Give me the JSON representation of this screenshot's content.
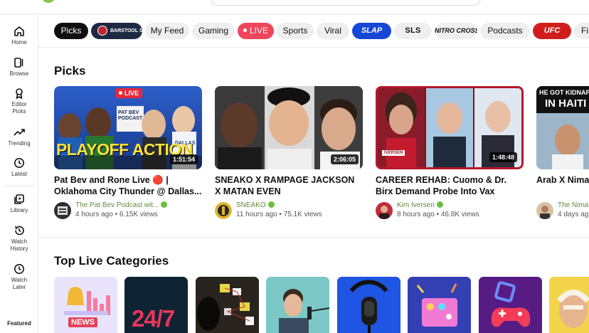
{
  "sidebar": {
    "items": [
      {
        "label": "Home",
        "icon": "home-icon"
      },
      {
        "label": "Browse",
        "icon": "browse-icon"
      },
      {
        "label": "Editor\nPicks",
        "icon": "award-icon"
      },
      {
        "label": "Trending",
        "icon": "trending-icon"
      },
      {
        "label": "Latest",
        "icon": "clock-icon"
      },
      {
        "label": "Library",
        "icon": "library-icon"
      },
      {
        "label": "Watch\nHistory",
        "icon": "history-icon"
      },
      {
        "label": "Watch\nLater",
        "icon": "clock-icon"
      }
    ],
    "featured_label": "Featured"
  },
  "chips": [
    {
      "label": "Picks",
      "style": "selected"
    },
    {
      "label": "BARSTOOL SPORTS",
      "style": "barstool"
    },
    {
      "label": "My Feed",
      "style": "default"
    },
    {
      "label": "Gaming",
      "style": "default"
    },
    {
      "label": "LIVE",
      "style": "live"
    },
    {
      "label": "Sports",
      "style": "default"
    },
    {
      "label": "Viral",
      "style": "default"
    },
    {
      "label": "SLAP",
      "style": "slap"
    },
    {
      "label": "SLS",
      "style": "logo"
    },
    {
      "label": "NITRO CROSS",
      "style": "logo"
    },
    {
      "label": "Podcasts",
      "style": "default"
    },
    {
      "label": "UFC",
      "style": "ufc"
    },
    {
      "label": "Fi",
      "style": "default"
    }
  ],
  "picks": {
    "section_title": "Picks",
    "videos": [
      {
        "title": "Pat Bev and Rone Live 🔴 | Oklahoma City Thunder @ Dallas...",
        "channel": "The Pat Bev Podcast wit...",
        "stats": "4 hours ago • 6.15K views",
        "duration": "1:51:54",
        "live_badge": "LIVE",
        "thumb_caption": "PLAYOFF ACTION",
        "thumb_caption_2": "PAT BEV PODCAST",
        "thumb_caption_3": "DALLAS"
      },
      {
        "title": "SNEAKO X RAMPAGE JACKSON X MATAN EVEN",
        "channel": "SNEAKO",
        "stats": "11 hours ago • 75.1K views",
        "duration": "2:06:05"
      },
      {
        "title": "CAREER REHAB: Cuomo & Dr. Birx Demand Probe Into Vax Injuries |...",
        "channel": "Kim Iversen",
        "stats": "8 hours ago • 46.8K views",
        "duration": "1:48:48",
        "thumb_caption": "IVERSEN"
      },
      {
        "title": "Arab X Nima",
        "channel": "The Nima",
        "stats": "4 days ag",
        "thumb_caption": "HE GOT KIDNAP",
        "thumb_caption_2": "IN HAITI"
      }
    ]
  },
  "categories": {
    "section_title": "Top Live Categories",
    "items": [
      {
        "name": "news",
        "label": "NEWS"
      },
      {
        "name": "24-7",
        "label": "24/7"
      },
      {
        "name": "conspiracy"
      },
      {
        "name": "podcast-host"
      },
      {
        "name": "microphone"
      },
      {
        "name": "music"
      },
      {
        "name": "gaming"
      },
      {
        "name": "irl"
      }
    ]
  },
  "colors": {
    "brand_green": "#85c742",
    "live_red": "#f0455a",
    "slap_blue": "#1546d6",
    "ufc_red": "#d21d1d",
    "channel_green": "#5e8a3c"
  }
}
